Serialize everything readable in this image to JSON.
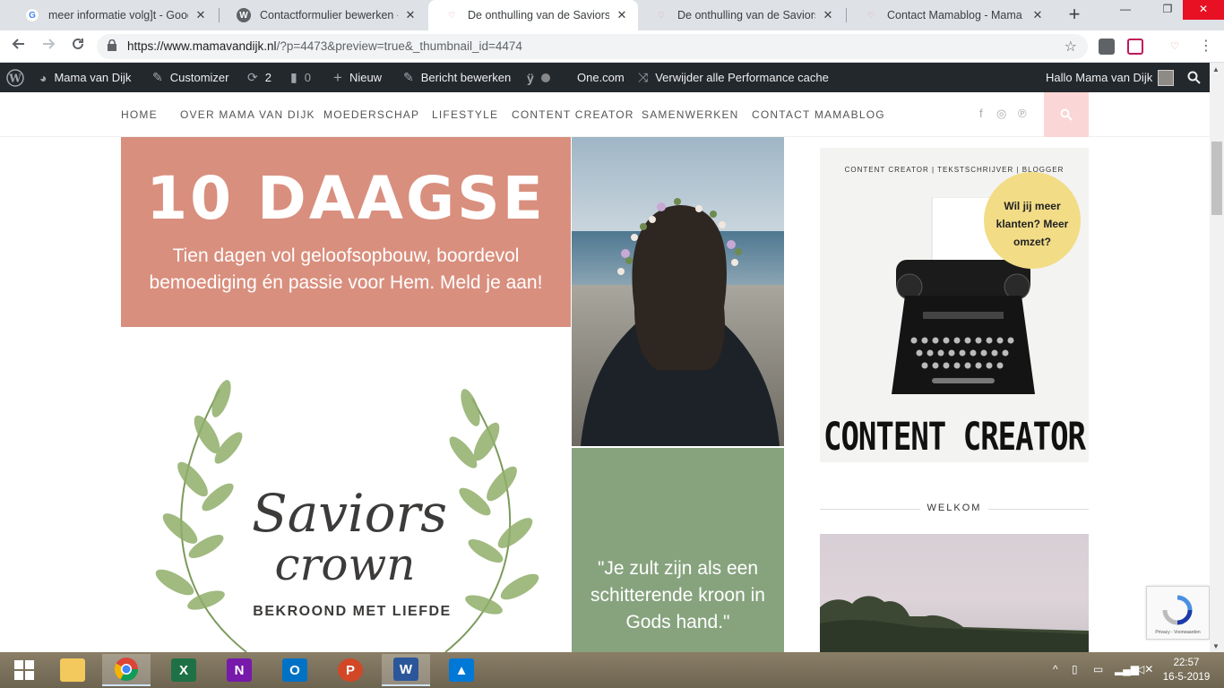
{
  "browser": {
    "tabs": [
      {
        "title": "meer informatie volg]t - Google",
        "favicon": "google-icon"
      },
      {
        "title": "Contactformulier bewerken ‹ Ma",
        "favicon": "wordpress-icon"
      },
      {
        "title": "De onthulling van de Saviorscro",
        "favicon": "mamablog-icon",
        "active": true
      },
      {
        "title": "De onthulling van de Saviorscro",
        "favicon": "mamablog-icon"
      },
      {
        "title": "Contact Mamablog - Mama van",
        "favicon": "mamablog-icon"
      }
    ],
    "new_tab": "+",
    "window_controls": {
      "minimize": "—",
      "maximize": "❐",
      "close": "✕"
    },
    "url_host": "https://www.mamavandijk.nl",
    "url_rest": "/?p=4473&preview=true&_thumbnail_id=4474"
  },
  "adminbar": {
    "site_name": "Mama van Dijk",
    "customizer": "Customizer",
    "updates_count": "2",
    "comments_count": "0",
    "new": "Nieuw",
    "edit_post": "Bericht bewerken",
    "onecom": "One.com",
    "cache": "Verwijder alle Performance cache",
    "greeting": "Hallo Mama van Dijk"
  },
  "nav": {
    "items": [
      "HOME",
      "OVER MAMA VAN DIJK",
      "MOEDERSCHAP",
      "LIFESTYLE",
      "CONTENT CREATOR",
      "SAMENWERKEN",
      "CONTACT MAMABLOG"
    ],
    "social": [
      "f",
      "◎",
      "℗"
    ]
  },
  "promo": {
    "headline": "10 DAAGSE",
    "text": "Tien dagen vol geloofsopbouw, boordevol bemoediging én passie voor Hem. Meld je aan!",
    "logo_line1": "Saviors",
    "logo_line2": "crown",
    "logo_tagline": "BEKROOND MET LIEFDE",
    "quote": "\"Je zult zijn als een schitterende kroon in Gods hand.\"",
    "colors": {
      "pink": "#d98f7e",
      "green": "#87a37e"
    }
  },
  "sidebar": {
    "cc_top": "CONTENT CREATOR | TEKSTSCHRIJVER | BLOGGER",
    "cc_bubble": "Wil jij meer klanten? Meer omzet?",
    "cc_title": "CONTENT CREATOR",
    "welcome_heading": "WELKOM"
  },
  "recaptcha": "Privacy - Voorwaarden",
  "taskbar": {
    "time": "22:57",
    "date": "16-5-2019"
  }
}
